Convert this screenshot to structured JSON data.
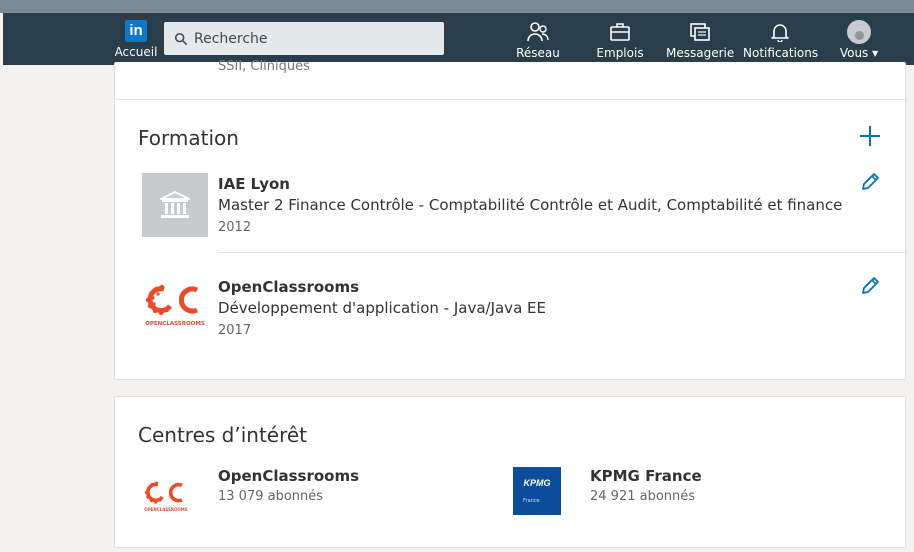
{
  "nav": {
    "home_label": "Accueil",
    "logo_text": "in",
    "search_placeholder": "Recherche",
    "items": [
      {
        "label": "Réseau",
        "icon": "network-icon"
      },
      {
        "label": "Emplois",
        "icon": "briefcase-icon"
      },
      {
        "label": "Messagerie",
        "icon": "messaging-icon"
      },
      {
        "label": "Notifications",
        "icon": "bell-icon"
      },
      {
        "label": "Vous ▾",
        "icon": "avatar"
      }
    ]
  },
  "previous_section": {
    "text": "SSII, Cliniques"
  },
  "education": {
    "title": "Formation",
    "entries": [
      {
        "school": "IAE Lyon",
        "degree": "Master 2 Finance Contrôle - Comptabilité Contrôle et Audit, Comptabilité et finance",
        "year": "2012",
        "logo": "institution-icon"
      },
      {
        "school": "OpenClassrooms",
        "degree": "Développement d'application - Java/Java EE",
        "year": "2017",
        "logo": "openclassrooms-logo",
        "logo_caption": "OPENCLASSROOMS"
      }
    ]
  },
  "interests": {
    "title": "Centres d’intérêt",
    "items": [
      {
        "name": "OpenClassrooms",
        "followers": "13 079 abonnés",
        "logo_caption": "OPENCLASSROOMS"
      },
      {
        "name": "KPMG France",
        "followers": "24 921 abonnés",
        "logo_text": "KPMG",
        "logo_sub": "France"
      }
    ]
  },
  "colors": {
    "nav_bg": "#293e4a",
    "accent": "#0073b1",
    "page_bg": "#f3f2f0"
  }
}
